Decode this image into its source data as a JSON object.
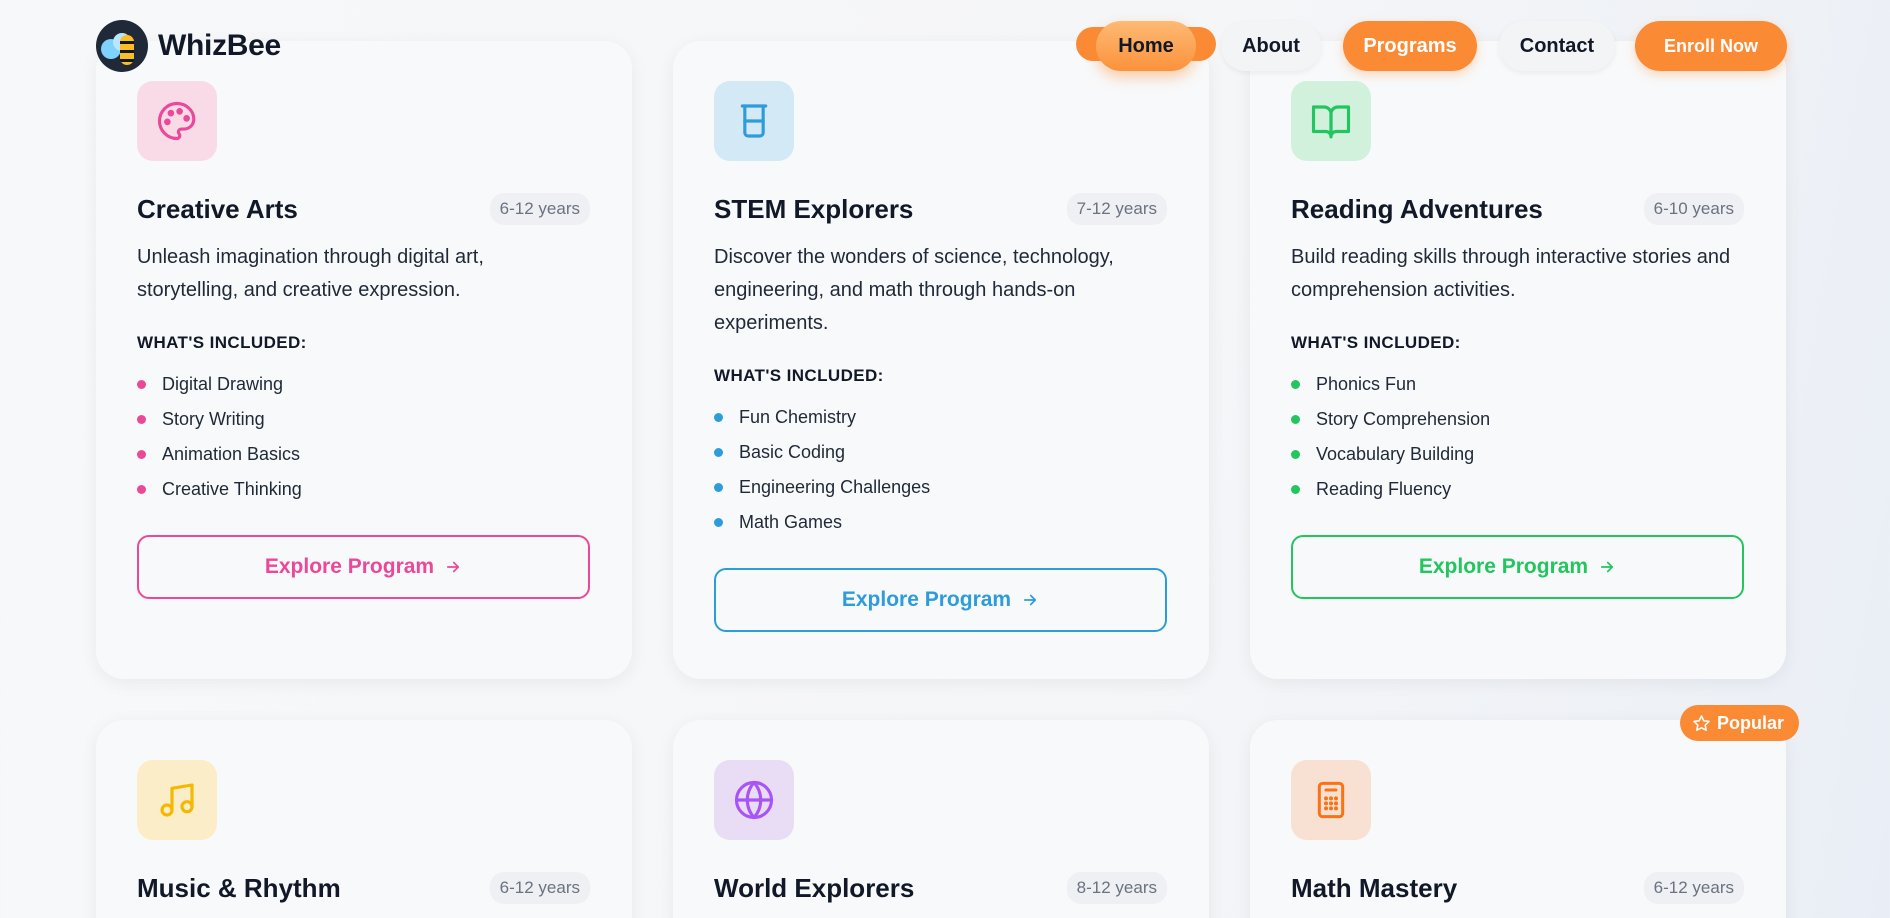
{
  "brand": {
    "name": "WhizBee"
  },
  "nav": {
    "home": "Home",
    "about": "About",
    "programs": "Programs",
    "contact": "Contact",
    "enroll": "Enroll Now"
  },
  "colors": {
    "accent": "#fb8a34",
    "pink": "#ec4899",
    "blue": "#2d9cdb",
    "green": "#22c55e",
    "yellow": "#f5b800",
    "purple": "#a855f7",
    "orange": "#f97316"
  },
  "included_label": "WHAT'S INCLUDED:",
  "explore_label": "Explore Program",
  "popular_badge": "Popular",
  "programs": [
    {
      "icon": "palette-icon",
      "title": "Creative Arts",
      "age": "6-12 years",
      "description": "Unleash imagination through digital art, storytelling, and creative expression.",
      "features": [
        "Digital Drawing",
        "Story Writing",
        "Animation Basics",
        "Creative Thinking"
      ]
    },
    {
      "icon": "beaker-icon",
      "title": "STEM Explorers",
      "age": "7-12 years",
      "description": "Discover the wonders of science, technology, engineering, and math through hands-on experiments.",
      "features": [
        "Fun Chemistry",
        "Basic Coding",
        "Engineering Challenges",
        "Math Games"
      ]
    },
    {
      "icon": "book-open-icon",
      "title": "Reading Adventures",
      "age": "6-10 years",
      "description": "Build reading skills through interactive stories and comprehension activities.",
      "features": [
        "Phonics Fun",
        "Story Comprehension",
        "Vocabulary Building",
        "Reading Fluency"
      ]
    },
    {
      "icon": "music-note-icon",
      "title": "Music & Rhythm",
      "age": "6-12 years"
    },
    {
      "icon": "globe-icon",
      "title": "World Explorers",
      "age": "8-12 years"
    },
    {
      "icon": "calculator-icon",
      "title": "Math Mastery",
      "age": "6-12 years"
    }
  ]
}
